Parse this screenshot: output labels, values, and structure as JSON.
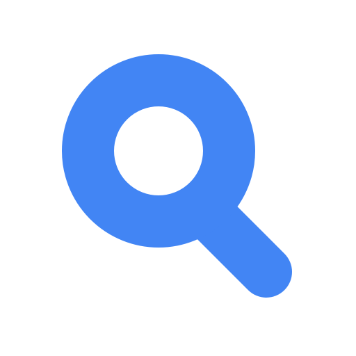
{
  "icon": {
    "name": "search-icon",
    "color": "#4285F4",
    "background": "#FFFFFF"
  }
}
